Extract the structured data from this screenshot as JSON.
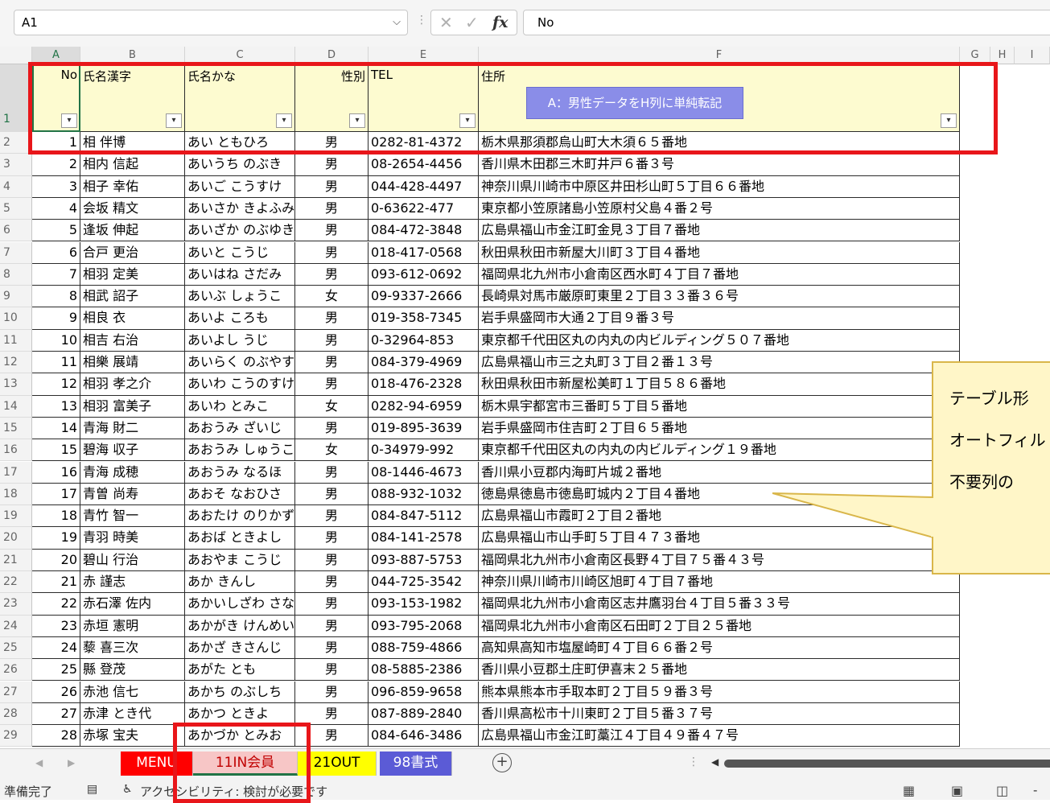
{
  "formula_bar": {
    "name_box": "A1",
    "name_box_arrow": "⌵",
    "separator": "⋮",
    "cancel": "✕",
    "enter": "✓",
    "fx": "fx",
    "formula": "No"
  },
  "columns": [
    "A",
    "B",
    "C",
    "D",
    "E",
    "F",
    "G",
    "H",
    "I"
  ],
  "header_row": {
    "row_number": "1",
    "no": "No",
    "kanji": "氏名漢字",
    "kana": "氏名かな",
    "gender": "性別",
    "tel": "TEL",
    "address": "住所",
    "filter_glyph": "▾"
  },
  "macro_button": {
    "label": "A：男性データをH列に単純転記"
  },
  "rows": [
    {
      "r": "2",
      "no": "1",
      "kanji": "相 伴博",
      "kana": "あい ともひろ",
      "gender": "男",
      "tel": "0282-81-4372",
      "address": "栃木県那須郡烏山町大木須６５番地"
    },
    {
      "r": "3",
      "no": "2",
      "kanji": "相内 信起",
      "kana": "あいうち のぶき",
      "gender": "男",
      "tel": "08-2654-4456",
      "address": "香川県木田郡三木町井戸６番３号"
    },
    {
      "r": "4",
      "no": "3",
      "kanji": "相子 幸佑",
      "kana": "あいご こうすけ",
      "gender": "男",
      "tel": "044-428-4497",
      "address": "神奈川県川崎市中原区井田杉山町５丁目６６番地"
    },
    {
      "r": "5",
      "no": "4",
      "kanji": "会坂 精文",
      "kana": "あいさか きよふみ",
      "gender": "男",
      "tel": "0-63622-477",
      "address": "東京都小笠原諸島小笠原村父島４番２号"
    },
    {
      "r": "6",
      "no": "5",
      "kanji": "逢坂 伸起",
      "kana": "あいざか のぶゆき",
      "gender": "男",
      "tel": "084-472-3848",
      "address": "広島県福山市金江町金見３丁目７番地"
    },
    {
      "r": "7",
      "no": "6",
      "kanji": "合戸 更治",
      "kana": "あいと こうじ",
      "gender": "男",
      "tel": "018-417-0568",
      "address": "秋田県秋田市新屋大川町３丁目４番地"
    },
    {
      "r": "8",
      "no": "7",
      "kanji": "相羽 定美",
      "kana": "あいはね さだみ",
      "gender": "男",
      "tel": "093-612-0692",
      "address": "福岡県北九州市小倉南区西水町４丁目７番地"
    },
    {
      "r": "9",
      "no": "8",
      "kanji": "相武 詔子",
      "kana": "あいぶ しょうこ",
      "gender": "女",
      "tel": "09-9337-2666",
      "address": "長崎県対馬市厳原町東里２丁目３３番３６号"
    },
    {
      "r": "10",
      "no": "9",
      "kanji": "相良 衣",
      "kana": "あいよ ころも",
      "gender": "男",
      "tel": "019-358-7345",
      "address": "岩手県盛岡市大通２丁目９番３号"
    },
    {
      "r": "11",
      "no": "10",
      "kanji": "相吉 右治",
      "kana": "あいよし うじ",
      "gender": "男",
      "tel": "0-32964-853",
      "address": "東京都千代田区丸の内丸の内ビルディング５０７番地"
    },
    {
      "r": "12",
      "no": "11",
      "kanji": "相樂 展靖",
      "kana": "あいらく のぶやす",
      "gender": "男",
      "tel": "084-379-4969",
      "address": "広島県福山市三之丸町３丁目２番１３号"
    },
    {
      "r": "13",
      "no": "12",
      "kanji": "相羽 孝之介",
      "kana": "あいわ こうのすけ",
      "gender": "男",
      "tel": "018-476-2328",
      "address": "秋田県秋田市新屋松美町１丁目５８６番地"
    },
    {
      "r": "14",
      "no": "13",
      "kanji": "相羽 富美子",
      "kana": "あいわ とみこ",
      "gender": "女",
      "tel": "0282-94-6959",
      "address": "栃木県宇都宮市三番町５丁目５番地"
    },
    {
      "r": "15",
      "no": "14",
      "kanji": "青海 財二",
      "kana": "あおうみ ざいじ",
      "gender": "男",
      "tel": "019-895-3639",
      "address": "岩手県盛岡市住吉町２丁目６５番地"
    },
    {
      "r": "16",
      "no": "15",
      "kanji": "碧海 収子",
      "kana": "あおうみ しゅうこ",
      "gender": "女",
      "tel": "0-34979-992",
      "address": "東京都千代田区丸の内丸の内ビルディング１９番地"
    },
    {
      "r": "17",
      "no": "16",
      "kanji": "青海 成穂",
      "kana": "あおうみ なるほ",
      "gender": "男",
      "tel": "08-1446-4673",
      "address": "香川県小豆郡内海町片城２番地"
    },
    {
      "r": "18",
      "no": "17",
      "kanji": "青曽 尚寿",
      "kana": "あおそ なおひさ",
      "gender": "男",
      "tel": "088-932-1032",
      "address": "徳島県徳島市徳島町城内２丁目４番地"
    },
    {
      "r": "19",
      "no": "18",
      "kanji": "青竹 智一",
      "kana": "あおたけ のりかず",
      "gender": "男",
      "tel": "084-847-5112",
      "address": "広島県福山市霞町２丁目２番地"
    },
    {
      "r": "20",
      "no": "19",
      "kanji": "青羽 時美",
      "kana": "あおば ときよし",
      "gender": "男",
      "tel": "084-141-2578",
      "address": "広島県福山市山手町５丁目４７３番地"
    },
    {
      "r": "21",
      "no": "20",
      "kanji": "碧山 行治",
      "kana": "あおやま こうじ",
      "gender": "男",
      "tel": "093-887-5753",
      "address": "福岡県北九州市小倉南区長野４丁目７５番４３号"
    },
    {
      "r": "22",
      "no": "21",
      "kanji": "赤 謹志",
      "kana": "あか きんし",
      "gender": "男",
      "tel": "044-725-3542",
      "address": "神奈川県川崎市川崎区旭町４丁目７番地"
    },
    {
      "r": "23",
      "no": "22",
      "kanji": "赤石澤 佐内",
      "kana": "あかいしざわ さない",
      "gender": "男",
      "tel": "093-153-1982",
      "address": "福岡県北九州市小倉南区志井鷹羽台４丁目５番３３号"
    },
    {
      "r": "24",
      "no": "23",
      "kanji": "赤垣 憲明",
      "kana": "あかがき けんめい",
      "gender": "男",
      "tel": "093-795-2068",
      "address": "福岡県北九州市小倉南区石田町２丁目２５番地"
    },
    {
      "r": "25",
      "no": "24",
      "kanji": "藜 喜三次",
      "kana": "あかざ きさんじ",
      "gender": "男",
      "tel": "088-759-4866",
      "address": "高知県高知市塩屋崎町４丁目６６番２号"
    },
    {
      "r": "26",
      "no": "25",
      "kanji": "縣 登茂",
      "kana": "あがた とも",
      "gender": "男",
      "tel": "08-5885-2386",
      "address": "香川県小豆郡土庄町伊喜末２５番地"
    },
    {
      "r": "27",
      "no": "26",
      "kanji": "赤池 信七",
      "kana": "あかち のぶしち",
      "gender": "男",
      "tel": "096-859-9658",
      "address": "熊本県熊本市手取本町２丁目５９番３号"
    },
    {
      "r": "28",
      "no": "27",
      "kanji": "赤津 とき代",
      "kana": "あかつ ときよ",
      "gender": "男",
      "tel": "087-889-2840",
      "address": "香川県高松市十川東町２丁目５番３７号"
    },
    {
      "r": "29",
      "no": "28",
      "kanji": "赤塚 宝夫",
      "kana": "あかづか とみお",
      "gender": "男",
      "tel": "084-646-3486",
      "address": "広島県福山市金江町藁江４丁目４９番４７号"
    }
  ],
  "callout": {
    "line1": "テーブル形",
    "line2": "オートフィル",
    "line3": "不要列の"
  },
  "tabs": {
    "nav_prev": "◀",
    "nav_next": "▶",
    "items": [
      {
        "label": "MENU",
        "bg": "#ff0000",
        "fg": "#ffffff"
      },
      {
        "label": "11IN会員",
        "bg": "#f7c6c6",
        "fg": "#c00000"
      },
      {
        "label": "21OUT",
        "bg": "#ffff00",
        "fg": "#000000"
      },
      {
        "label": "98書式",
        "bg": "#5b5bd6",
        "fg": "#ffffff"
      }
    ],
    "add": "+",
    "scroll_dots": "⋮",
    "scroll_left": "◀"
  },
  "status": {
    "ready": "準備完了",
    "accessibility": "アクセシビリティ: 検討が必要です",
    "view_normal": "▦",
    "view_page_layout": "▣",
    "view_page_break": "◫",
    "zoom_minus": "-"
  },
  "colors": {
    "accent": "#217346",
    "header_fill": "#fdfbd0",
    "annotation_red": "#e8161a",
    "macro_button": "#8a8de8",
    "callout_fill": "#fff6c8"
  }
}
